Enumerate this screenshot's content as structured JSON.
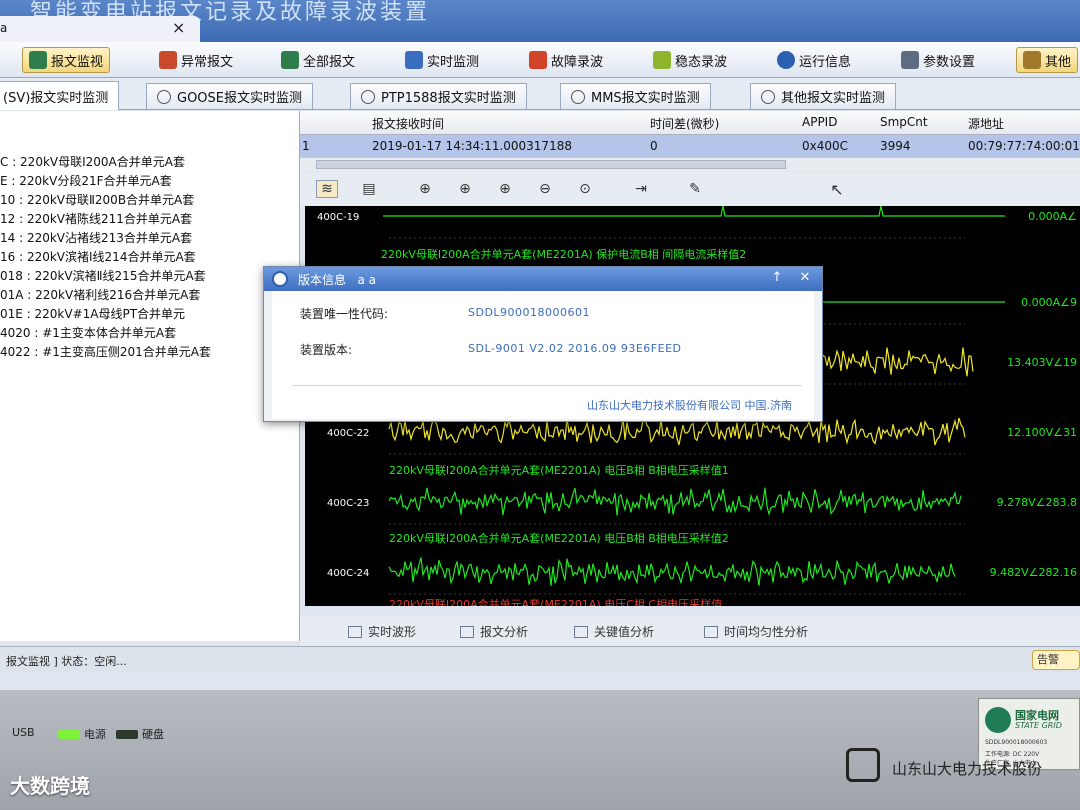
{
  "window": {
    "title": "智能变电站报文记录及故障录波装置",
    "tab_label": "a",
    "tab_close": "×"
  },
  "toolbar": {
    "items": [
      {
        "label": "报文监视",
        "icon": "monitor-icon",
        "color": "#2f7d4a"
      },
      {
        "label": "异常报文",
        "icon": "exception-icon",
        "color": "#c94a2a"
      },
      {
        "label": "全部报文",
        "icon": "all-messages-icon",
        "color": "#2f7d4a"
      },
      {
        "label": "实时监测",
        "icon": "realtime-icon",
        "color": "#3a6cc0"
      },
      {
        "label": "故障录波",
        "icon": "fault-record-icon",
        "color": "#d2442a"
      },
      {
        "label": "稳态录波",
        "icon": "steady-record-icon",
        "color": "#8fb52e"
      },
      {
        "label": "运行信息",
        "icon": "info-icon",
        "color": "#2d5fb0"
      },
      {
        "label": "参数设置",
        "icon": "settings-icon",
        "color": "#5d6c80"
      },
      {
        "label": "其他",
        "icon": "other-icon",
        "color": "#a07a2a"
      }
    ]
  },
  "subtabs": [
    {
      "label": "(SV)报文实时监测"
    },
    {
      "label": "GOOSE报文实时监测"
    },
    {
      "label": "PTP1588报文实时监测"
    },
    {
      "label": "MMS报文实时监测"
    },
    {
      "label": "其他报文实时监测"
    }
  ],
  "left_list": [
    "C : 220kV母联Ⅰ200A合并单元A套",
    "E : 220kV分段21F合并单元A套",
    "10 : 220kV母联Ⅱ200B合并单元A套",
    "12 : 220kV褚陈线211合并单元A套",
    "14 : 220kV沾褚线213合并单元A套",
    "16 : 220kV滨褚Ⅰ线214合并单元A套",
    "018 : 220kV滨褚Ⅱ线215合并单元A套",
    "01A : 220kV褚利线216合并单元A套",
    "01E : 220kV#1A母线PT合并单元",
    "4020 : #1主变本体合并单元A套",
    "4022 : #1主变高压侧201合并单元A套"
  ],
  "table": {
    "headers": [
      "报文接收时间",
      "时间差(微秒)",
      "APPID",
      "SmpCnt",
      "源地址"
    ],
    "row": {
      "index": "1",
      "time": "2019-01-17  14:34:11.000317188",
      "diff": "0",
      "appid": "0x400C",
      "smpcnt": "3994",
      "src": "00:79:77:74:00:01"
    }
  },
  "wave_tools": [
    "sv-wave-icon",
    "chart-icon",
    "zoom-in-icon",
    "zoom-in-h-icon",
    "zoom-in-v-icon",
    "zoom-out-icon",
    "zoom-reset-icon",
    "cursor-icon",
    "color-icon"
  ],
  "scope": {
    "channels": [
      {
        "id": "400C-19",
        "desc": "",
        "value": "0.000A∠",
        "color": "#22e622",
        "kind": "pulse"
      },
      {
        "id": "",
        "desc": "220kV母联Ⅰ200A合并单元A套(ME2201A) 保护电流B相 间隔电流采样值2",
        "value": "0.000A∠9",
        "color": "#22e622",
        "kind": "flat"
      },
      {
        "id": "",
        "desc": "",
        "value": "13.403V∠19",
        "color": "#f0e62a",
        "kind": "noise"
      },
      {
        "id": "400C-22",
        "desc": "",
        "value": "12.100V∠31",
        "color": "#f0e62a",
        "kind": "noise"
      },
      {
        "id": "400C-23",
        "desc": "220kV母联Ⅰ200A合并单元A套(ME2201A) 电压B相 B相电压采样值1",
        "value": "9.278V∠283.8",
        "color": "#22e622",
        "kind": "noise"
      },
      {
        "id": "400C-24",
        "desc": "220kV母联Ⅰ200A合并单元A套(ME2201A) 电压B相 B相电压采样值2",
        "value": "9.482V∠282.16",
        "color": "#22e622",
        "kind": "noise"
      }
    ],
    "footer_label": "220kV母联Ⅰ200A合并单元A套(ME2201A) 电压C相 C相电压采样值"
  },
  "bottom_tabs": [
    "实时波形",
    "报文分析",
    "关键值分析",
    "时间均匀性分析"
  ],
  "status": {
    "text": "报文监视 ]   状态：空闲...",
    "warn": "告警"
  },
  "dialog": {
    "title": "版本信息",
    "title_suffix": "a a",
    "label_code": "装置唯一性代码:",
    "value_code": "SDDL900018000601",
    "label_version": "装置版本:",
    "value_version": "SDL-9001  V2.02  2016.09  93E6FEED",
    "company": "山东山大电力技术股份有限公司  中国.济南",
    "btn_up": "↑",
    "btn_close": "✕"
  },
  "device": {
    "usb": "USB",
    "power": "电源",
    "disk": "硬盘",
    "grid_cn": "国家电网",
    "grid_en": "STATE GRID",
    "serial": "SDDL900018000603",
    "plate_l1": "工作电源:  DC 220V",
    "plate_l2": "生产厂家:  山大电力",
    "brand": "山东山大电力技术股份",
    "watermark": "大数跨境"
  },
  "colors": {
    "scope_bg": "#000000",
    "green": "#22e622",
    "yellow": "#f0e62a",
    "accent": "#3a6cc0"
  }
}
